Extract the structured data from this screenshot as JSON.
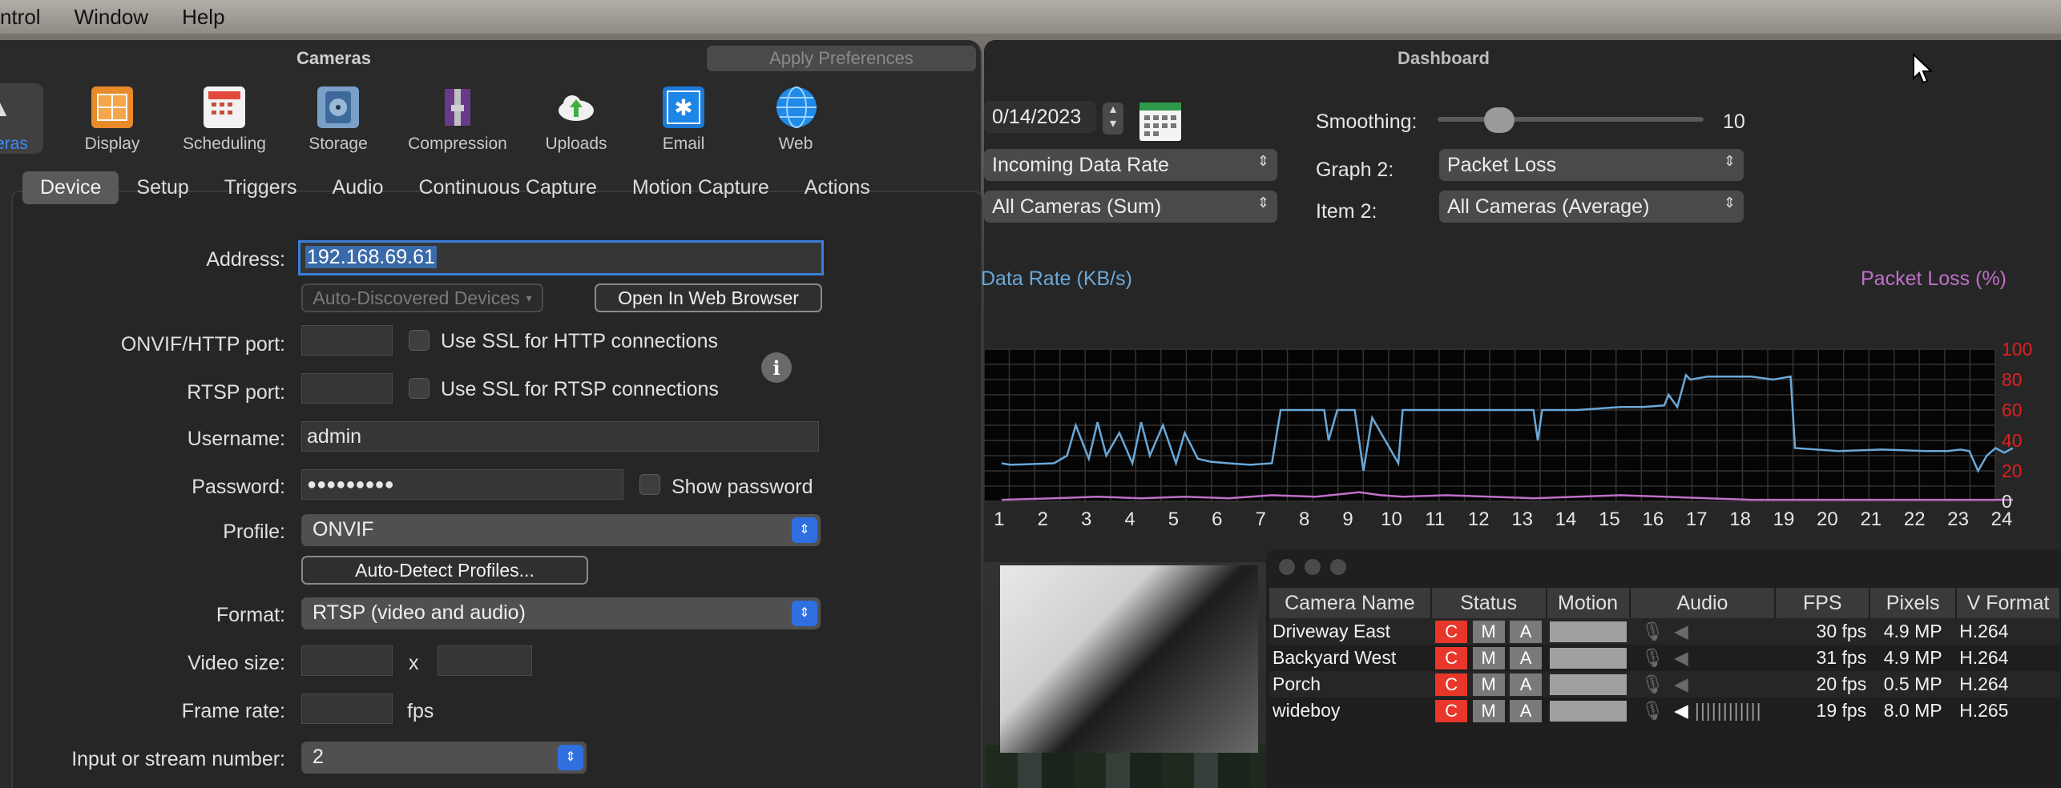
{
  "menubar": {
    "items": [
      "ntrol",
      "Window",
      "Help"
    ]
  },
  "cameras_window": {
    "title": "Cameras",
    "apply_button": "Apply Preferences",
    "toolbar": [
      {
        "label": "eras",
        "icon": "camera-icon"
      },
      {
        "label": "Display",
        "icon": "display-icon"
      },
      {
        "label": "Scheduling",
        "icon": "calendar-icon"
      },
      {
        "label": "Storage",
        "icon": "disk-icon"
      },
      {
        "label": "Compression",
        "icon": "compression-icon"
      },
      {
        "label": "Uploads",
        "icon": "cloud-upload-icon"
      },
      {
        "label": "Email",
        "icon": "email-icon"
      },
      {
        "label": "Web",
        "icon": "globe-icon"
      }
    ],
    "tabs": [
      "Device",
      "Setup",
      "Triggers",
      "Audio",
      "Continuous Capture",
      "Motion Capture",
      "Actions"
    ],
    "active_tab": "Device",
    "form": {
      "address_label": "Address:",
      "address_value": "192.168.69.61",
      "auto_discovered": "Auto-Discovered Devices",
      "open_browser": "Open In Web Browser",
      "onvif_label": "ONVIF/HTTP port:",
      "ssl_http": "Use SSL for HTTP connections",
      "rtsp_label": "RTSP port:",
      "ssl_rtsp": "Use SSL for RTSP connections",
      "username_label": "Username:",
      "username_value": "admin",
      "password_label": "Password:",
      "password_value": "●●●●●●●●●",
      "show_password": "Show password",
      "profile_label": "Profile:",
      "profile_value": "ONVIF",
      "auto_detect": "Auto-Detect Profiles...",
      "format_label": "Format:",
      "format_value": "RTSP (video and audio)",
      "video_size_label": "Video size:",
      "video_size_x": "x",
      "frame_rate_label": "Frame rate:",
      "fps_unit": "fps",
      "input_label": "Input or stream number:",
      "input_value": "2"
    }
  },
  "dashboard": {
    "title": "Dashboard",
    "date": "0/14/2023",
    "graph1": "Incoming Data Rate",
    "item1": "All Cameras (Sum)",
    "smoothing_label": "Smoothing:",
    "smoothing_value": "10",
    "graph2_label": "Graph 2:",
    "graph2": "Packet Loss",
    "item2_label": "Item 2:",
    "item2": "All Cameras (Average)"
  },
  "chart_data": {
    "type": "line",
    "left_axis_label": "Data Rate (KB/s)",
    "right_axis_label": "Packet Loss (%)",
    "x_ticks": [
      "1",
      "2",
      "3",
      "4",
      "5",
      "6",
      "7",
      "8",
      "9",
      "10",
      "11",
      "12",
      "13",
      "14",
      "15",
      "16",
      "17",
      "18",
      "19",
      "20",
      "21",
      "22",
      "23",
      "24"
    ],
    "y2_ticks": [
      "100",
      "80",
      "60",
      "40",
      "20",
      "0"
    ],
    "y2_range": [
      0,
      100
    ],
    "series": [
      {
        "name": "Data Rate (KB/s)",
        "color": "#6aa8d8",
        "x": [
          0.8,
          1,
          2,
          2.3,
          2.5,
          2.8,
          3,
          3.2,
          3.5,
          3.8,
          4,
          4.2,
          4.5,
          4.8,
          5,
          5.3,
          5.6,
          6,
          6.5,
          7,
          7.2,
          7.5,
          8,
          8.2,
          8.3,
          8.5,
          8.9,
          9,
          9.1,
          9.3,
          9.7,
          9.9,
          10,
          10.5,
          11,
          12,
          13,
          13.1,
          13.2,
          14,
          15,
          15.5,
          16,
          16.1,
          16.3,
          16.5,
          16.6,
          17,
          18,
          18.5,
          18.9,
          19,
          19.5,
          20,
          21,
          22,
          22.5,
          22.8,
          23,
          23.2,
          23.4,
          23.6,
          23.8,
          24
        ],
        "y": [
          25,
          24,
          25,
          30,
          50,
          28,
          52,
          30,
          45,
          25,
          52,
          30,
          50,
          25,
          45,
          28,
          26,
          25,
          24,
          25,
          60,
          60,
          60,
          60,
          40,
          60,
          60,
          40,
          20,
          55,
          35,
          25,
          60,
          60,
          60,
          60,
          60,
          40,
          60,
          60,
          62,
          62,
          63,
          70,
          62,
          83,
          80,
          82,
          82,
          80,
          82,
          35,
          34,
          33,
          34,
          33,
          33,
          34,
          33,
          20,
          30,
          35,
          32,
          35
        ]
      },
      {
        "name": "Packet Loss (%)",
        "color": "#c070c8",
        "x": [
          0.8,
          2,
          3,
          4,
          5,
          6,
          7,
          8,
          9,
          9.5,
          10,
          11,
          12,
          13,
          14,
          15,
          16,
          17,
          18,
          19,
          20,
          21,
          22,
          23,
          24
        ],
        "y": [
          1,
          2,
          3,
          2,
          3,
          2,
          4,
          3,
          6,
          4,
          3,
          4,
          3,
          2,
          3,
          4,
          3,
          2,
          1,
          1,
          1,
          1,
          1,
          1,
          1
        ]
      }
    ],
    "grid": true
  },
  "camera_info": {
    "columns": [
      "Camera Name",
      "Status",
      "Motion",
      "Audio",
      "FPS",
      "Pixels",
      "V Format"
    ],
    "rows": [
      {
        "name": "Driveway East",
        "fps": "30",
        "unit": "fps",
        "pixels": "4.9 MP",
        "format": "H.264"
      },
      {
        "name": "Backyard West",
        "fps": "31",
        "unit": "fps",
        "pixels": "4.9 MP",
        "format": "H.264"
      },
      {
        "name": "Porch",
        "fps": "20",
        "unit": "fps",
        "pixels": "0.5 MP",
        "format": "H.264"
      },
      {
        "name": "wideboy",
        "fps": "19",
        "unit": "fps",
        "pixels": "8.0 MP",
        "format": "H.265"
      }
    ],
    "status_letters": [
      "C",
      "M",
      "A"
    ]
  }
}
